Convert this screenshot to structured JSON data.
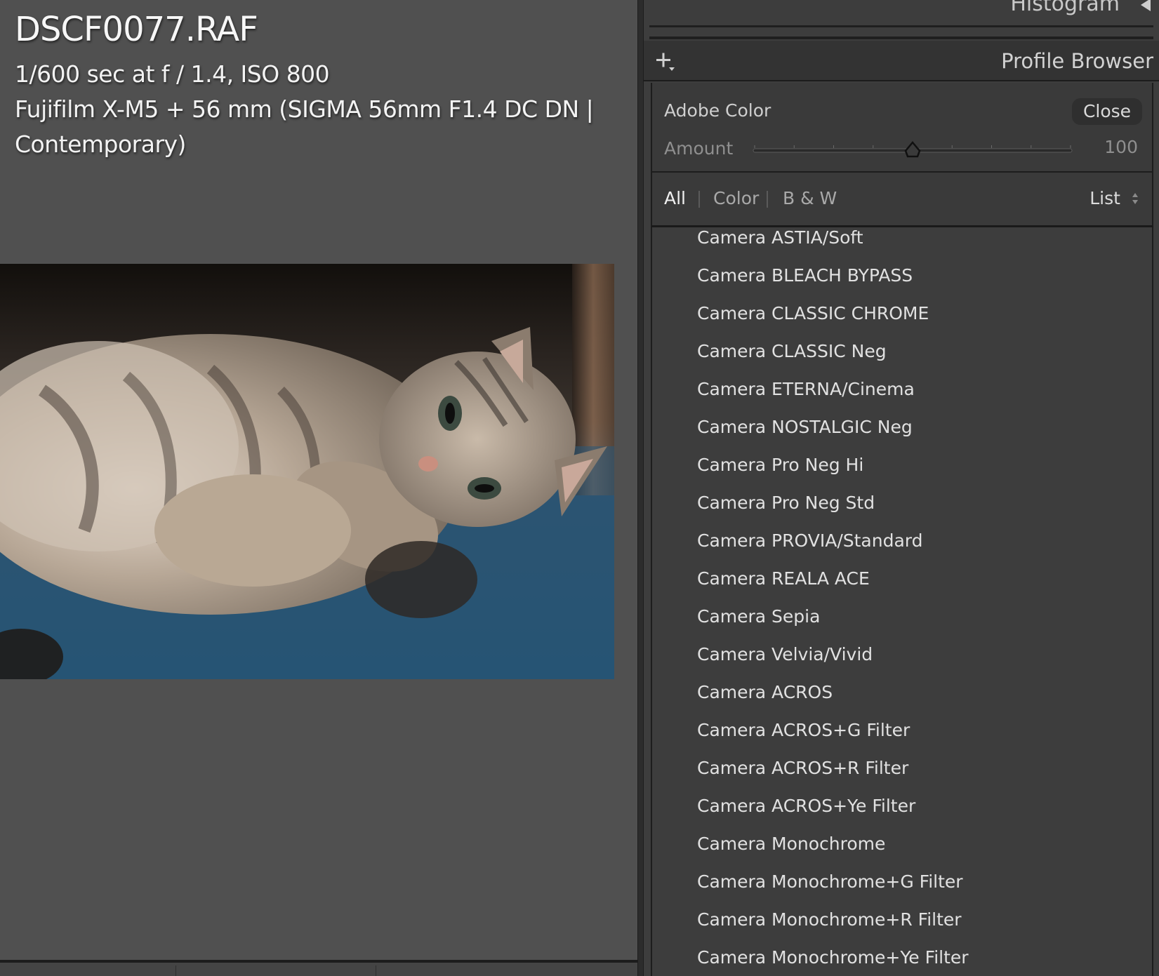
{
  "photo_info": {
    "filename": "DSCF0077.RAF",
    "exposure": "1/600 sec at f / 1.4, ISO 800",
    "camera_line_1": "Fujifilm X-M5 + 56 mm (SIGMA 56mm F1.4 DC DN |",
    "camera_line_2": "Contemporary)"
  },
  "right_panel": {
    "histogram_label": "Histogram",
    "profile_browser_title": "Profile Browser",
    "current_profile": "Adobe Color",
    "close_label": "Close",
    "amount_label": "Amount",
    "amount_value": "100",
    "amount_fraction": 0.5,
    "filters": {
      "all": "All",
      "color": "Color",
      "bw": "B & W",
      "active": "All"
    },
    "view_mode": "List"
  },
  "profiles": [
    "Camera ASTIA/Soft",
    "Camera BLEACH BYPASS",
    "Camera CLASSIC CHROME",
    "Camera CLASSIC Neg",
    "Camera ETERNA/Cinema",
    "Camera NOSTALGIC Neg",
    "Camera Pro Neg Hi",
    "Camera Pro Neg Std",
    "Camera PROVIA/Standard",
    "Camera REALA ACE",
    "Camera Sepia",
    "Camera Velvia/Vivid",
    "Camera ACROS",
    "Camera ACROS+G Filter",
    "Camera ACROS+R Filter",
    "Camera ACROS+Ye Filter",
    "Camera Monochrome",
    "Camera Monochrome+G Filter",
    "Camera Monochrome+R Filter",
    "Camera Monochrome+Ye Filter"
  ],
  "colors": {
    "background": "#505050",
    "panel": "#3d3d3d",
    "header": "#333333",
    "text_primary": "#e1e1e1",
    "text_dim": "#8f8f8f"
  }
}
